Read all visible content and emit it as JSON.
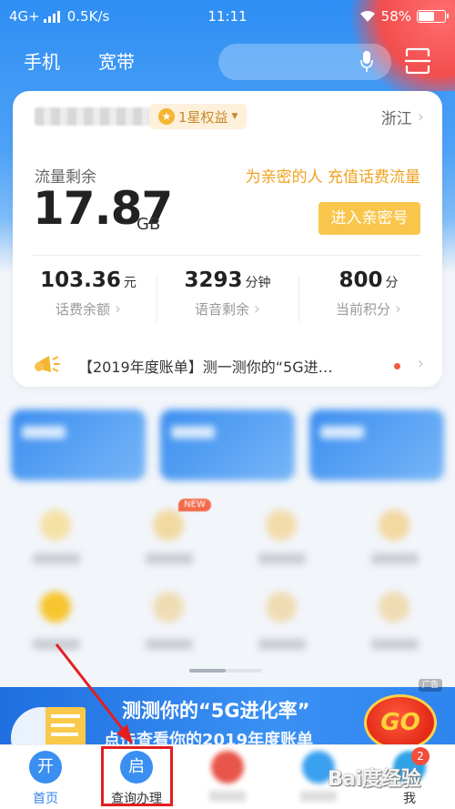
{
  "status_bar": {
    "network": "4G+",
    "speed": "0.5K/s",
    "time": "11:11",
    "battery": "58%",
    "battery_level": 0.58
  },
  "top_nav": {
    "tabs": [
      "手机",
      "宽带"
    ]
  },
  "account": {
    "star_badge": "1星权益",
    "province": "浙江"
  },
  "data_usage": {
    "label": "流量剩余",
    "value": "17.87",
    "unit": "GB",
    "promo": "为亲密的人 充值话费流量",
    "family_button": "进入亲密号"
  },
  "stats": [
    {
      "value": "103.36",
      "unit": "元",
      "label": "话费余额"
    },
    {
      "value": "3293",
      "unit": "分钟",
      "label": "语音剩余"
    },
    {
      "value": "800",
      "unit": "分",
      "label": "当前积分"
    }
  ],
  "notice": {
    "text": "【2019年度账单】测一测你的“5G进…"
  },
  "new_tag": "NEW",
  "ad": {
    "tag": "广告",
    "title": "测测你的“5G进化率”",
    "subtitle": "点击查看你的2019年度账单",
    "go": "GO"
  },
  "tab_bar": [
    {
      "icon_char": "开",
      "label": "首页"
    },
    {
      "icon_char": "启",
      "label": "查询办理"
    },
    {
      "icon_char": "",
      "label": ""
    },
    {
      "icon_char": "",
      "label": ""
    },
    {
      "icon_char": "",
      "label": "我",
      "badge": "2"
    }
  ],
  "watermark": "Bai度经验",
  "colors": {
    "primary": "#2f84ee",
    "gold": "#f0a220",
    "annotation_red": "#e31f1f"
  }
}
